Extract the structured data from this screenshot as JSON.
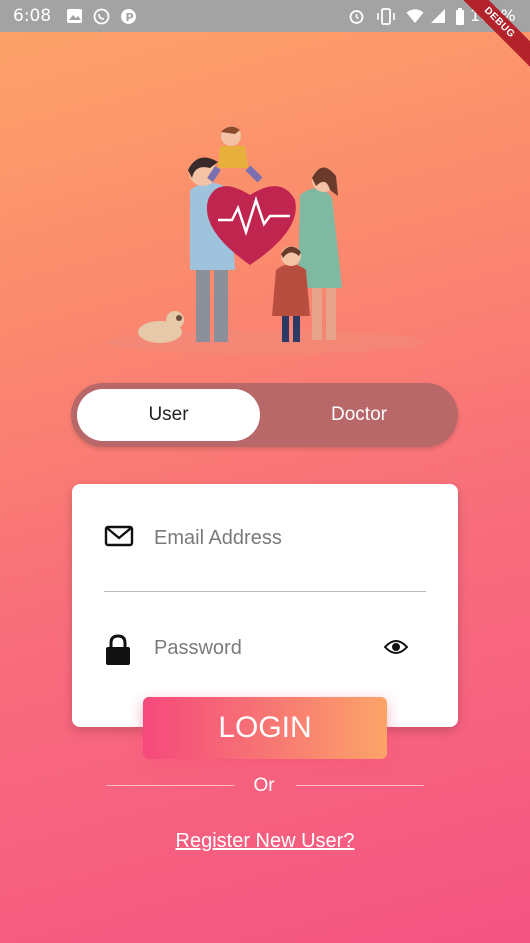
{
  "status_bar": {
    "time": "6:08",
    "battery": "100%",
    "debug_label": "DEBUG",
    "icons": [
      "image-icon",
      "whatsapp-icon",
      "p-app-icon",
      "alarm-icon",
      "vibrate-icon",
      "wifi-icon",
      "signal-icon",
      "battery-icon"
    ]
  },
  "illustration": {
    "icon": "family-health-illustration",
    "colors": {
      "heart": "#c0254f",
      "shadow": "#f08a7a"
    }
  },
  "toggle": {
    "user_label": "User",
    "doctor_label": "Doctor",
    "selected": "User"
  },
  "form": {
    "email_placeholder": "Email Address",
    "email_value": "",
    "password_placeholder": "Password",
    "password_value": "",
    "email_icon": "mail-icon",
    "password_icon": "lock-icon",
    "visibility_icon": "eye-icon"
  },
  "login_label": "LOGIN",
  "or_label": "Or",
  "register_label": "Register New User?",
  "colors": {
    "gradient_top": "#fca468",
    "gradient_bottom": "#f45584",
    "toggle_bg": "#b9686a",
    "button_start": "#f5497c",
    "button_end": "#fca468"
  }
}
